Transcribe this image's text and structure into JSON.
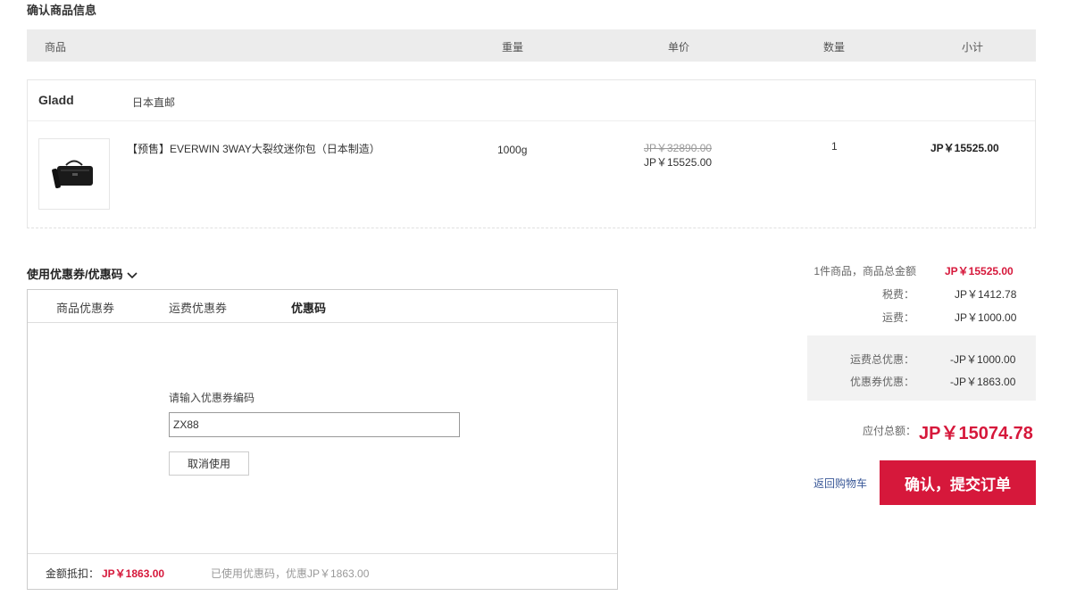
{
  "page": {
    "section_title": "确认商品信息"
  },
  "table_header": {
    "product": "商品",
    "weight": "重量",
    "unit_price": "单价",
    "quantity": "数量",
    "subtotal": "小计"
  },
  "store": {
    "name": "Gladd",
    "shipping": "日本直邮"
  },
  "item": {
    "name": "【预售】EVERWIN 3WAY大裂纹迷你包（日本制造）",
    "weight": "1000g",
    "original_price": "JP￥32890.00",
    "price": "JP￥15525.00",
    "quantity": "1",
    "subtotal": "JP￥15525.00",
    "image_icon": "black-bag-image"
  },
  "coupon": {
    "toggle_label": "使用优惠券/优惠码",
    "tabs": [
      "商品优惠券",
      "运费优惠券",
      "优惠码"
    ],
    "active_tab": "优惠码",
    "code_label": "请输入优惠券编码",
    "code_value": "ZX88",
    "cancel_label": "取消使用",
    "deduct_label": "金额抵扣：",
    "deduct_amount": "JP￥1863.00",
    "used_text": "已使用优惠码，优惠JP￥1863.00"
  },
  "summary": {
    "goods_label": "1件商品，商品总金额",
    "goods_value": "JP￥15525.00",
    "tax_label": "税费：",
    "tax_value": "JP￥1412.78",
    "shipping_label": "运费：",
    "shipping_value": "JP￥1000.00",
    "ship_discount_label": "运费总优惠：",
    "ship_discount_value": "-JP￥1000.00",
    "coupon_discount_label": "优惠券优惠：",
    "coupon_discount_value": "-JP￥1863.00",
    "total_label": "应付总额：",
    "total_value": "JP￥15074.78",
    "back_label": "返回购物车",
    "submit_label": "确认，提交订单"
  },
  "colors": {
    "accent": "#d6183b",
    "header_bg": "#ececec",
    "link": "#3b5998"
  }
}
